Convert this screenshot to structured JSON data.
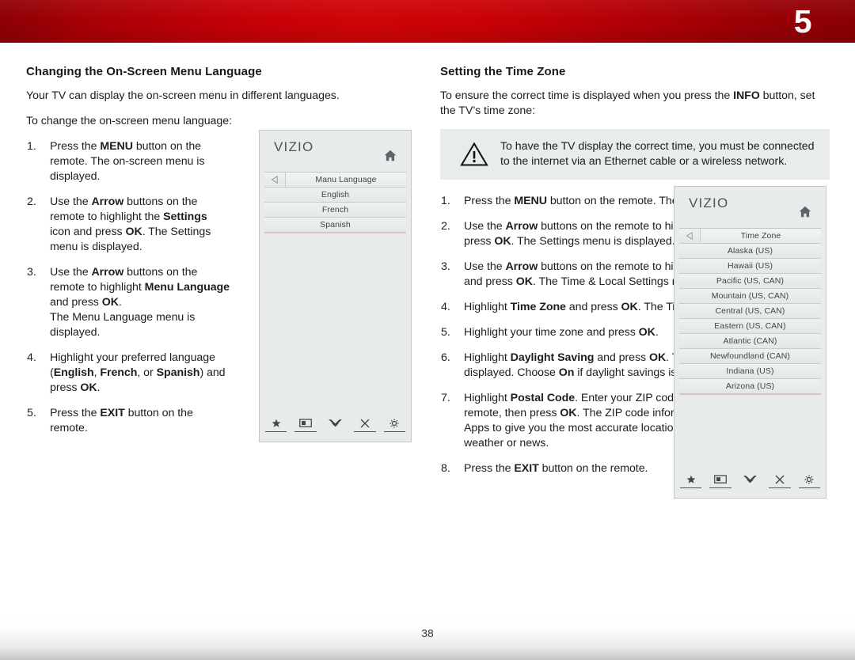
{
  "header": {
    "chapter_number": "5",
    "banner_color": "#c60007"
  },
  "left_column": {
    "section_title": "Changing the On-Screen Menu Language",
    "intro_1": "Your TV can display the on-screen menu in different languages.",
    "intro_2": "To change the on-screen menu language:",
    "steps": [
      "Press the <b>MENU</b> button on the remote. The on-screen menu is displayed.",
      "Use the <b>Arrow</b> buttons on the remote to highlight the <b>Settings</b> icon and press <b>OK</b>. The Settings menu is displayed.",
      "Use the <b>Arrow</b> buttons on the remote to highlight <b>Menu Language</b> and press <b>OK</b>.<br>The Menu Language menu is displayed.",
      "Highlight your preferred language (<b>English</b>, <b>French</b>, or <b>Spanish</b>) and press <b>OK</b>.",
      "Press the <b>EXIT</b> button on the remote."
    ]
  },
  "right_column": {
    "section_title": "Setting the Time Zone",
    "intro_1": "To ensure the correct time is displayed when you press the <b>INFO</b> button, set the TV’s time zone:",
    "note": "To have the TV display the correct time, you must be connected to the internet via an Ethernet cable or a wireless network.",
    "steps": [
      "Press the <b>MENU</b> button on the remote. The on-screen menu is displayed.",
      "Use the <b>Arrow</b> buttons on the remote to highlight the <b>Settings</b> icon and press <b>OK</b>. The Settings menu is displayed.",
      "Use the <b>Arrow</b> buttons on the remote to highlight <b>Time &amp; Local Settings</b> and press <b>OK</b>. The Time &amp; Local Settings menu is displayed.",
      "Highlight <b>Time Zone</b> and press <b>OK</b>. The Time Zone menu is displayed.",
      "Highlight your time zone and press <b>OK</b>.",
      "Highlight <b>Daylight Saving</b> and press <b>OK</b>. The Daylight Saving menu is displayed. Choose <b>On</b> if daylight savings is in effect, or <b>Off</b> if it is not.",
      "Highlight <b>Postal Code</b>. Enter your ZIP code using the keypad on the remote, then press <b>OK</b>. The ZIP code information is often used by VIA Apps to give you the most accurate location-based information, such as weather or news.",
      "Press the <b>EXIT</b> button on the remote."
    ]
  },
  "tv_menu_language": {
    "brand": "VIZIO",
    "title": "Manu Language",
    "items": [
      "English",
      "French",
      "Spanish"
    ],
    "foot_icons": [
      "star-icon",
      "picture-icon",
      "chevron-down-icon",
      "close-x-icon",
      "gear-icon"
    ]
  },
  "tv_time_zone": {
    "brand": "VIZIO",
    "title": "Time Zone",
    "items": [
      "Alaska (US)",
      "Hawaii (US)",
      "Pacific (US, CAN)",
      "Mountain (US, CAN)",
      "Central (US, CAN)",
      "Eastern (US, CAN)",
      "Atlantic (CAN)",
      "Newfoundland (CAN)",
      "Indiana (US)",
      "Arizona (US)"
    ],
    "foot_icons": [
      "star-icon",
      "picture-icon",
      "chevron-down-icon",
      "close-x-icon",
      "gear-icon"
    ]
  },
  "footer": {
    "page_number": "38"
  }
}
